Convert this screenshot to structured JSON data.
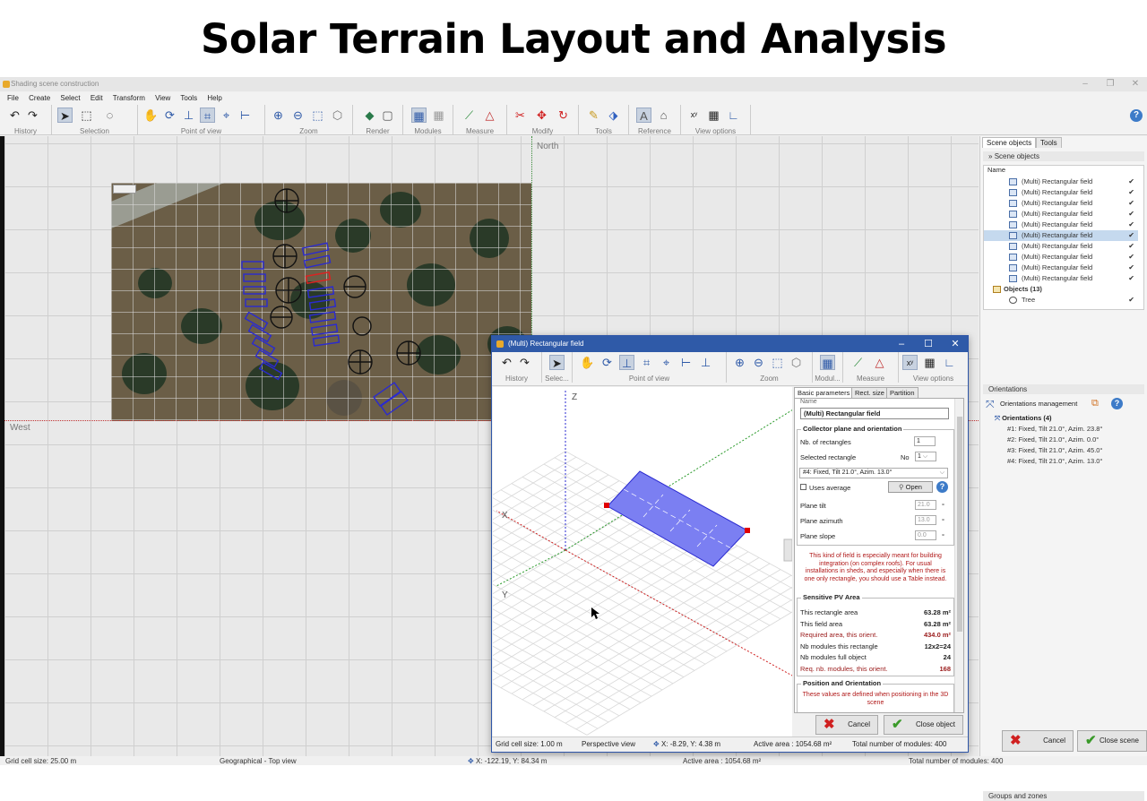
{
  "page_title": "Solar Terrain Layout and Analysis",
  "window": {
    "title": "Shading scene construction"
  },
  "menu": [
    "File",
    "Create",
    "Select",
    "Edit",
    "Transform",
    "View",
    "Tools",
    "Help"
  ],
  "toolbar_groups": [
    "History",
    "Selection",
    "Point of view",
    "Zoom",
    "Render",
    "Modules",
    "Measure",
    "Modify",
    "Tools",
    "Reference",
    "View options"
  ],
  "viewport": {
    "north_label": "North",
    "west_label": "West"
  },
  "status": {
    "grid_cell": "Grid cell size: 25.00 m",
    "view_mode": "Geographical - Top view",
    "coords": "X: -122.19, Y: 84.34 m",
    "active_area": "Active area : 1054.68 m²",
    "total_modules": "Total number of modules: 400"
  },
  "right_panel": {
    "tabs": [
      "Scene objects",
      "Tools"
    ],
    "scene_objects_header": "Scene objects",
    "name_col": "Name",
    "objects": [
      "(Multi) Rectangular field",
      "(Multi) Rectangular field",
      "(Multi) Rectangular field",
      "(Multi) Rectangular field",
      "(Multi) Rectangular field",
      "(Multi) Rectangular field",
      "(Multi) Rectangular field",
      "(Multi) Rectangular field",
      "(Multi) Rectangular field",
      "(Multi) Rectangular field"
    ],
    "objects_group": "Objects (13)",
    "tree_item": "Tree",
    "orientations_header": "Orientations",
    "orientations_mgmt": "Orientations management",
    "orientations_group": "Orientations (4)",
    "orientations": [
      "#1: Fixed, Tilt 21.0°, Azim. 23.8°",
      "#2: Fixed, Tilt 21.0°, Azim. 0.0°",
      "#3: Fixed, Tilt 21.0°, Azim. 45.0°",
      "#4: Fixed, Tilt 21.0°, Azim. 13.0°"
    ],
    "groups_zones": "Groups and zones",
    "cancel": "Cancel",
    "close_scene": "Close scene"
  },
  "dialog": {
    "title": "(Multi) Rectangular field",
    "toolbar_groups": [
      "History",
      "Selec...",
      "Point of view",
      "Zoom",
      "Modul...",
      "Measure",
      "View options"
    ],
    "axis_z": "Z",
    "axis_x": "X",
    "axis_y": "Y",
    "tabs": [
      "Basic parameters",
      "Rect. size",
      "Partition"
    ],
    "name_label": "Name",
    "name_value": "(Multi) Rectangular field",
    "collector_group": "Collector plane and orientation",
    "nb_rect_label": "Nb. of rectangles",
    "nb_rect_value": "1",
    "selected_rect_label": "Selected rectangle",
    "no_label": "No",
    "selected_rect_value": "1",
    "orientation_value": "#4: Fixed, Tilt 21.0°, Azim. 13.0°",
    "uses_average": "Uses average",
    "open_btn": "Open",
    "plane_tilt_label": "Plane tilt",
    "plane_tilt_value": "21.0",
    "plane_azimuth_label": "Plane azimuth",
    "plane_azimuth_value": "13.0",
    "plane_slope_label": "Plane slope",
    "plane_slope_value": "0.0",
    "deg": "°",
    "note": "This kind of field is especially meant for building integration (on complex roofs). For usual installations in sheds, and especially when there is one only rectangle, you should use a Table instead.",
    "sensitive_group": "Sensitive PV Area",
    "rows": [
      {
        "label": "This rectangle area",
        "value": "63.28 m²",
        "red": false
      },
      {
        "label": "This field area",
        "value": "63.28 m²",
        "red": false
      },
      {
        "label": "Required area, this orient.",
        "value": "434.0 m²",
        "red": true
      },
      {
        "label": "Nb modules this rectangle",
        "value": "12x2=24",
        "red": false
      },
      {
        "label": "Nb modules full object",
        "value": "24",
        "red": false
      },
      {
        "label": "Req. nb. modules, this orient.",
        "value": "168",
        "red": true
      }
    ],
    "position_group": "Position and Orientation",
    "position_note": "These values are defined when positioning in the 3D scene",
    "cancel": "Cancel",
    "close_object": "Close object",
    "status": {
      "grid": "Grid cell size:  1.00 m",
      "view": "Perspective view",
      "coords": "X: -8.29, Y: 4.38 m",
      "area": "Active area : 1054.68 m²",
      "modules": "Total number of modules: 400"
    }
  },
  "colors": {
    "accent": "#2f5aa8",
    "panel_fill": "#7b7ff2",
    "north_axis": "#3a8a3a",
    "west_axis": "#c03030",
    "handle": "#e00000"
  }
}
